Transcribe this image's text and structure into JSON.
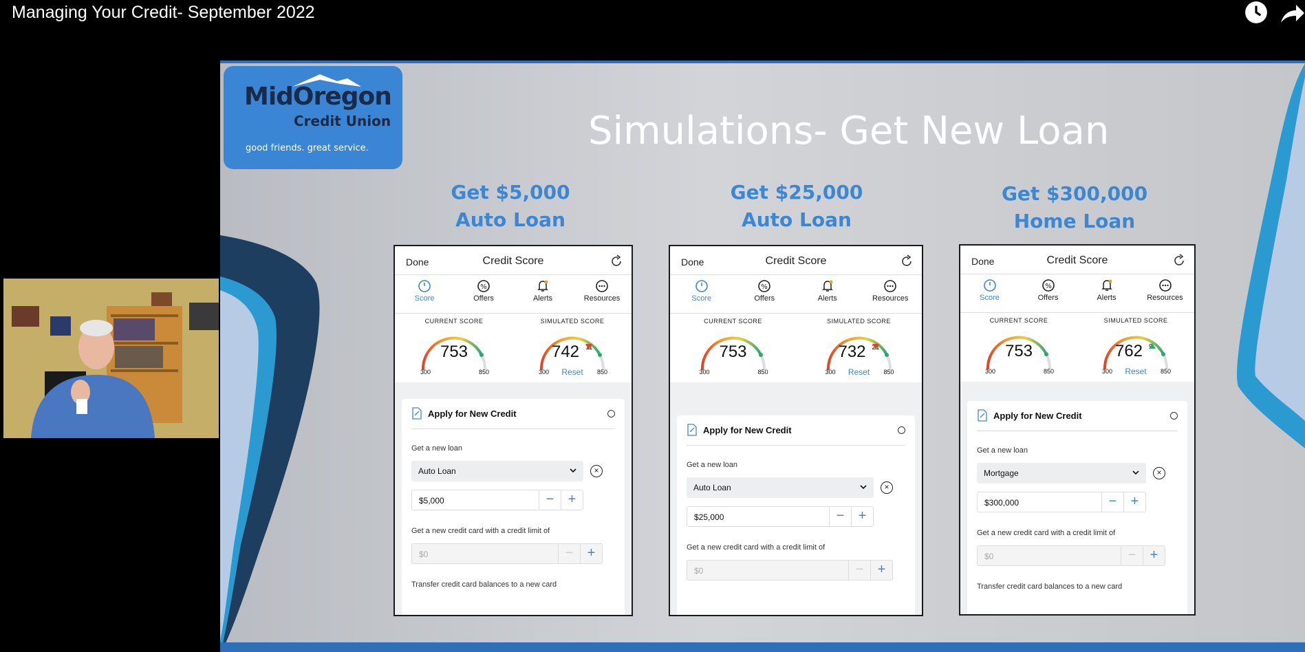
{
  "video": {
    "title": "Managing Your Credit- September 2022",
    "icons": [
      "clock-icon",
      "share-icon"
    ]
  },
  "logo": {
    "line1": "MidOregon",
    "line2": "Credit Union",
    "tagline": "good friends. great service."
  },
  "slide": {
    "title": "Simulations- Get New Loan"
  },
  "columns": [
    {
      "heading1": "Get $5,000",
      "heading2": "Auto Loan"
    },
    {
      "heading1": "Get $25,000",
      "heading2": "Auto Loan"
    },
    {
      "heading1": "Get $300,000",
      "heading2": "Home Loan"
    }
  ],
  "phones": [
    {
      "done": "Done",
      "title": "Credit Score",
      "tabs": [
        "Score",
        "Offers",
        "Alerts",
        "Resources"
      ],
      "current_label": "CURRENT SCORE",
      "simulated_label": "SIMULATED SCORE",
      "current_score": "753",
      "simulated_score": "742",
      "delta": "11",
      "delta_dir": "down",
      "min": "300",
      "max": "850",
      "reset": "Reset",
      "card_title": "Apply for New Credit",
      "loan_label": "Get a new loan",
      "loan_type": "Auto Loan",
      "loan_amount": "$5,000",
      "card_label": "Get a new credit card with a credit limit of",
      "card_amount": "$0",
      "transfer_label": "Transfer credit card balances to a new card"
    },
    {
      "done": "Done",
      "title": "Credit Score",
      "tabs": [
        "Score",
        "Offers",
        "Alerts",
        "Resources"
      ],
      "current_label": "CURRENT SCORE",
      "simulated_label": "SIMULATED SCORE",
      "current_score": "753",
      "simulated_score": "732",
      "delta": "21",
      "delta_dir": "down",
      "min": "300",
      "max": "850",
      "reset": "Reset",
      "card_title": "Apply for New Credit",
      "loan_label": "Get a new loan",
      "loan_type": "Auto Loan",
      "loan_amount": "$25,000",
      "card_label": "Get a new credit card with a credit limit of",
      "card_amount": "$0",
      "transfer_label": ""
    },
    {
      "done": "Done",
      "title": "Credit Score",
      "tabs": [
        "Score",
        "Offers",
        "Alerts",
        "Resources"
      ],
      "current_label": "CURRENT SCORE",
      "simulated_label": "SIMULATED SCORE",
      "current_score": "753",
      "simulated_score": "762",
      "delta": "9",
      "delta_dir": "up",
      "min": "300",
      "max": "850",
      "reset": "Reset",
      "card_title": "Apply for New Credit",
      "loan_label": "Get a new loan",
      "loan_type": "Mortgage",
      "loan_amount": "$300,000",
      "card_label": "Get a new credit card with a credit limit of",
      "card_amount": "$0",
      "transfer_label": "Transfer credit card balances to a new card"
    }
  ],
  "colors": {
    "accent": "#3d86d2",
    "slide_bar": "#2f6fb7",
    "logo_bg": "#3a86d4"
  }
}
